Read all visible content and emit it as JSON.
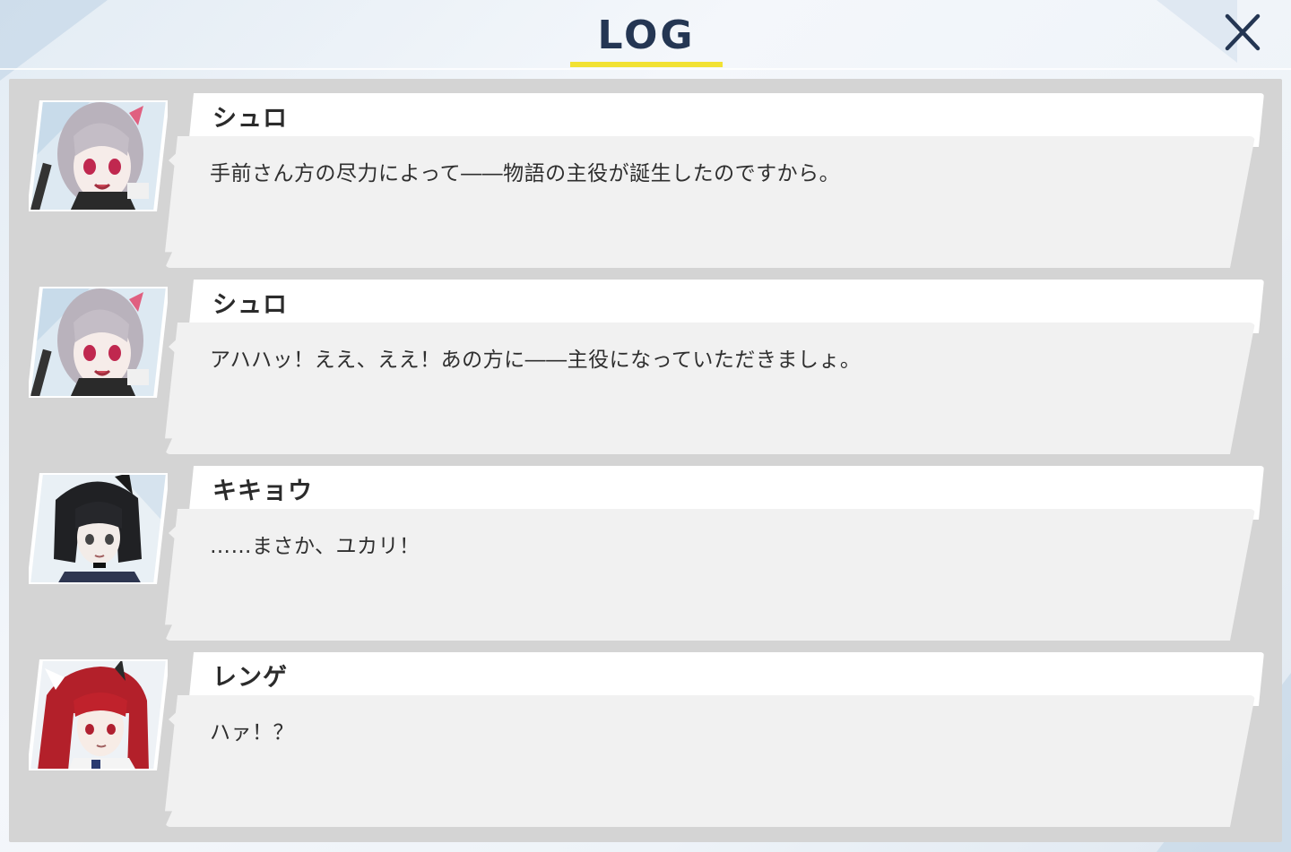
{
  "header": {
    "title": "LOG",
    "close_icon": "close-icon"
  },
  "entries": [
    {
      "speaker": "シュロ",
      "text": "手前さん方の尽力によって――物語の主役が誕生したのですから。",
      "portrait": "shuro-portrait"
    },
    {
      "speaker": "シュロ",
      "text": "アハハッ！ええ、ええ！あの方に――主役になっていただきましょ。",
      "portrait": "shuro-portrait"
    },
    {
      "speaker": "キキョウ",
      "text": "……まさか、ユカリ！",
      "portrait": "kikyou-portrait"
    },
    {
      "speaker": "レンゲ",
      "text": "ハァ！？",
      "portrait": "renge-portrait"
    }
  ],
  "colors": {
    "title": "#243653",
    "accent_underline": "#f2e233",
    "panel": "#d4d4d4",
    "name_tab": "#ffffff",
    "message_box": "#f1f1f1"
  }
}
